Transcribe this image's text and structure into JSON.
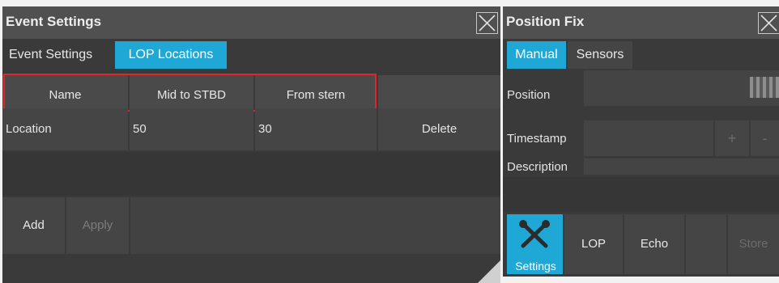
{
  "event_settings": {
    "title": "Event Settings",
    "tabs": [
      "Event Settings",
      "LOP Locations"
    ],
    "columns": [
      "Name",
      "Mid to STBD",
      "From stern"
    ],
    "rows": [
      {
        "name": "Location",
        "mid": "50",
        "stern": "30",
        "delete_label": "Delete"
      }
    ],
    "add_label": "Add",
    "apply_label": "Apply"
  },
  "position_fix": {
    "title": "Position Fix",
    "tabs": [
      "Manual",
      "Sensors"
    ],
    "position_label": "Position",
    "timestamp_label": "Timestamp",
    "plus_label": "+",
    "minus_label": "-",
    "description_label": "Description",
    "buttons": {
      "settings": "Settings",
      "lop": "LOP",
      "echo": "Echo",
      "store": "Store"
    }
  },
  "colors": {
    "accent": "#1fa8d6",
    "highlight_border": "#e0262b"
  }
}
